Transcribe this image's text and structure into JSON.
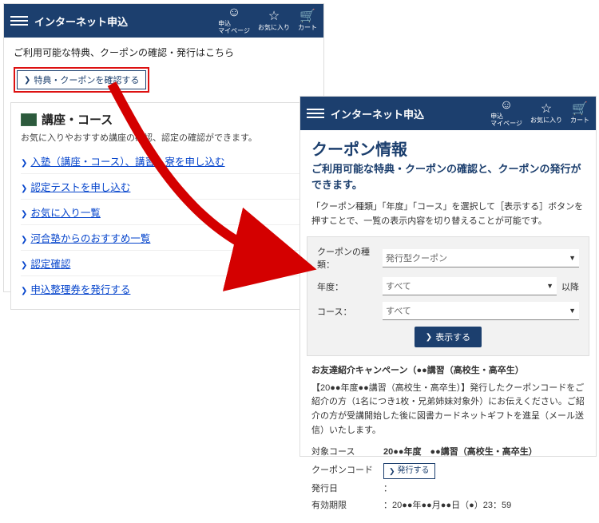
{
  "nav": {
    "title": "インターネット申込",
    "mypage": "申込\nマイページ",
    "fav": "お気に入り",
    "cart": "カート"
  },
  "left": {
    "intro": "ご利用可能な特典、クーポンの確認・発行はこちら",
    "check_btn": "特典・クーポンを確認する",
    "card_title": "講座・コース",
    "card_desc": "お気に入りやおすすめ講座の確認、認定の確認ができます。",
    "links": [
      "入塾（講座・コース）、講習・寮を申し込む",
      "認定テストを申し込む",
      "お気に入り一覧",
      "河合塾からのおすすめ一覧",
      "認定確認",
      "申込整理券を発行する"
    ]
  },
  "right": {
    "title": "クーポン情報",
    "subtitle": "ご利用可能な特典・クーポンの確認と、クーポンの発行ができます。",
    "desc": "「クーポン種類」「年度」「コース」を選択して［表示する］ボタンを押すことで、一覧の表示内容を切り替えることが可能です。",
    "filter": {
      "type_label": "クーポンの種類：",
      "type_value": "発行型クーポン",
      "year_label": "年度：",
      "year_value": "すべて",
      "year_after": "以降",
      "course_label": "コース：",
      "course_value": "すべて",
      "show_btn": "表示する"
    },
    "campaign": {
      "heading": "お友達紹介キャンペーン（●●講習（高校生・高卒生）",
      "body": "【20●●年度●●講習（高校生・高卒生）】発行したクーポンコードをご紹介の方（1名につき1枚・兄弟姉妹対象外）にお伝えください。ご紹介の方が受講開始した後に図書カードネットギフトを進呈（メール送信）いたします。",
      "rows": {
        "course_k": "対象コース",
        "course_v": "20●●年度　●●講習（高校生・高卒生）",
        "code_k": "クーポンコード",
        "issue_btn": "発行する",
        "date_k": "発行日",
        "date_v": "：",
        "expire_k": "有効期限",
        "expire_v": "：20●●年●●月●●日（●）23：59"
      }
    }
  }
}
